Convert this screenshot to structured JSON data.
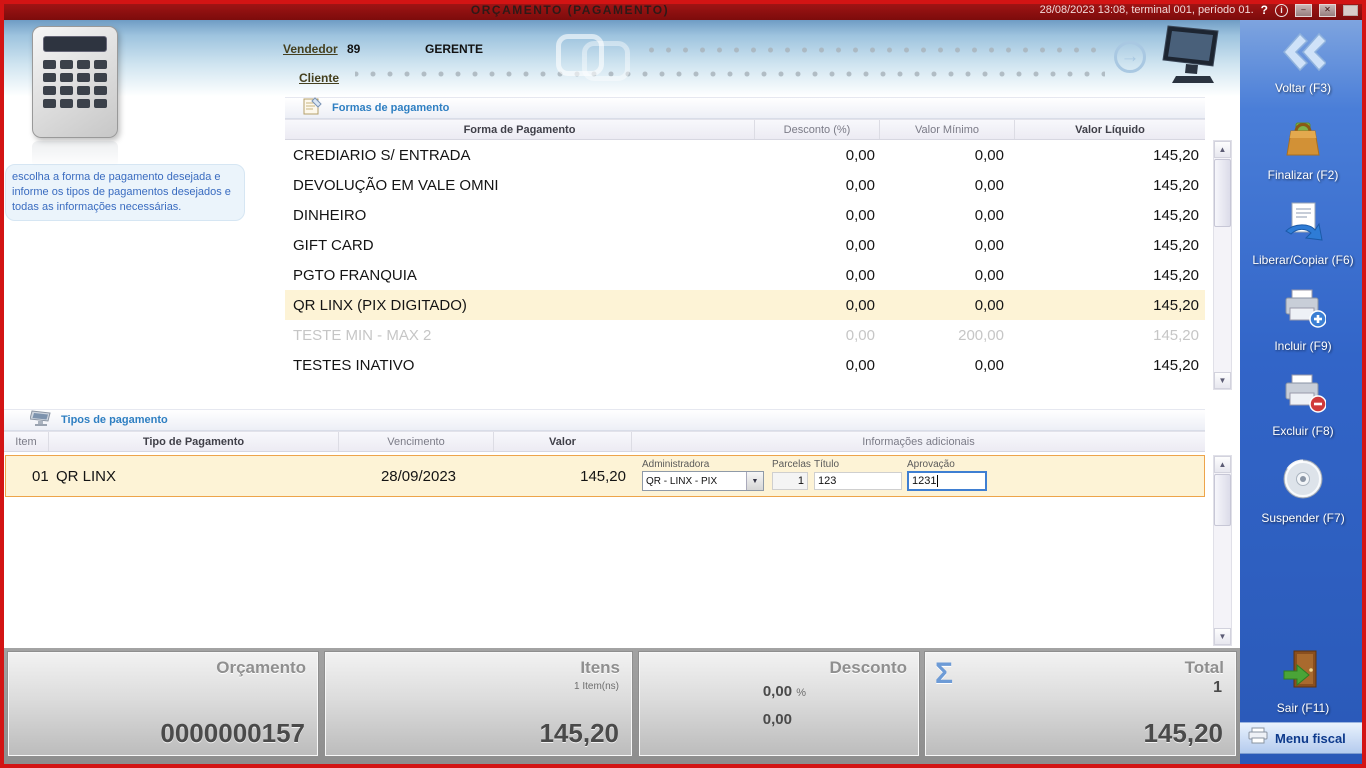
{
  "colors": {
    "titlebar_red": "#8e1010",
    "sidebar_blue": "#2f63c6",
    "selected_row_bg": "#fdf3d6",
    "selected_row_border": "#eda44a",
    "section_title_blue": "#2e7fc2"
  },
  "titlebar": {
    "title": "ORÇAMENTO (PAGAMENTO)",
    "status": "28/08/2023 13:08, terminal 001, período 01.",
    "help": "?",
    "info": "i"
  },
  "icons": {
    "minimize": "–",
    "close": "✕",
    "scroll_up": "▲",
    "scroll_down": "▼",
    "dropdown_arrow": "▼",
    "go_arrow": "→"
  },
  "header": {
    "vendedor_label": "Vendedor",
    "vendedor_code": "89",
    "vendedor_name": "GERENTE",
    "cliente_label": "Cliente"
  },
  "instructions": "escolha a forma de pagamento desejada e informe os tipos de pagamentos desejados e todas as informações necessárias.",
  "formas": {
    "title": "Formas de pagamento",
    "columns": [
      "Forma de Pagamento",
      "Desconto (%)",
      "Valor Mínimo",
      "Valor Líquido"
    ],
    "rows": [
      {
        "name": "CREDIARIO S/ ENTRADA",
        "desconto": "0,00",
        "minimo": "0,00",
        "liquido": "145,20"
      },
      {
        "name": "DEVOLUÇÃO EM VALE OMNI",
        "desconto": "0,00",
        "minimo": "0,00",
        "liquido": "145,20"
      },
      {
        "name": "DINHEIRO",
        "desconto": "0,00",
        "minimo": "0,00",
        "liquido": "145,20"
      },
      {
        "name": "GIFT CARD",
        "desconto": "0,00",
        "minimo": "0,00",
        "liquido": "145,20"
      },
      {
        "name": "PGTO FRANQUIA",
        "desconto": "0,00",
        "minimo": "0,00",
        "liquido": "145,20"
      },
      {
        "name": "QR LINX (PIX DIGITADO)",
        "desconto": "0,00",
        "minimo": "0,00",
        "liquido": "145,20"
      },
      {
        "name": "TESTE MIN - MAX 2",
        "desconto": "0,00",
        "minimo": "200,00",
        "liquido": "145,20"
      },
      {
        "name": "TESTES INATIVO",
        "desconto": "0,00",
        "minimo": "0,00",
        "liquido": "145,20"
      }
    ]
  },
  "tipos": {
    "title": "Tipos de pagamento",
    "columns": [
      "Item",
      "Tipo de Pagamento",
      "Vencimento",
      "Valor",
      "Informações adicionais"
    ],
    "row": {
      "item": "01",
      "tipo": "QR LINX",
      "vencimento": "28/09/2023",
      "valor": "145,20",
      "administradora_label": "Administradora",
      "administradora_value": "QR - LINX - PIX",
      "parcelas_label": "Parcelas",
      "parcelas_value": "1",
      "titulo_label": "Título",
      "titulo_value": "123",
      "aprovacao_label": "Aprovação",
      "aprovacao_value": "1231"
    }
  },
  "summary": {
    "orcamento_label": "Orçamento",
    "orcamento_value": "0000000157",
    "itens_label": "Itens",
    "itens_sub": "1 Item(ns)",
    "itens_value": "145,20",
    "desconto_label": "Desconto",
    "desconto_percent": "0,00",
    "desconto_percent_symbol": "%",
    "desconto_value": "0,00",
    "total_label": "Total",
    "total_sigma": "Σ",
    "total_count": "1",
    "total_value": "145,20"
  },
  "sidebar": {
    "buttons": [
      {
        "label": "Voltar (F3)",
        "icon": "back-chevrons"
      },
      {
        "label": "Finalizar (F2)",
        "icon": "shopping-bag"
      },
      {
        "label": "Liberar/Copiar (F6)",
        "icon": "document-copy"
      },
      {
        "label": "Incluir (F9)",
        "icon": "printer-plus"
      },
      {
        "label": "Excluir (F8)",
        "icon": "printer-minus"
      },
      {
        "label": "Suspender (F7)",
        "icon": "cd-disc"
      },
      {
        "label": "Sair (F11)",
        "icon": "exit-door"
      }
    ],
    "menu_fiscal": "Menu fiscal"
  }
}
